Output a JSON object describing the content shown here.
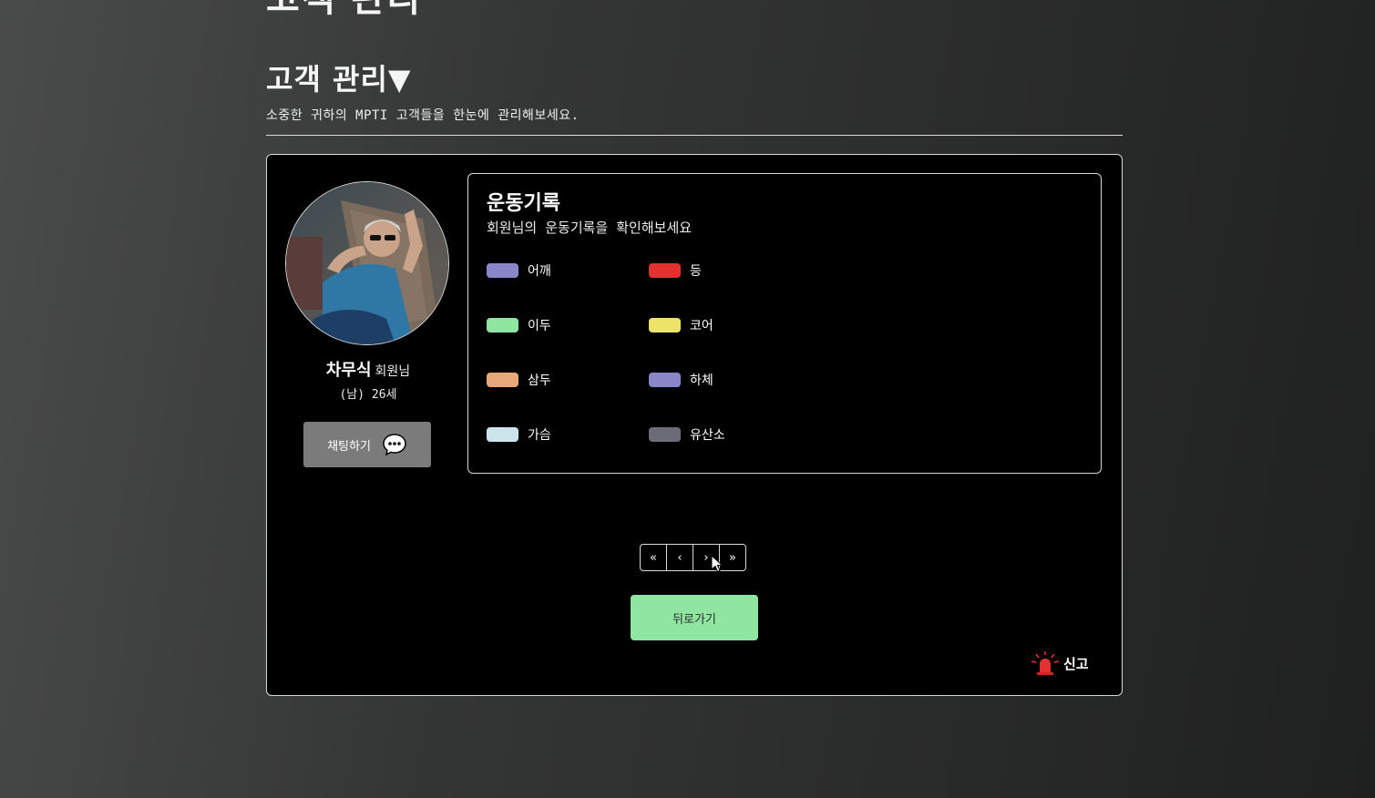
{
  "page": {
    "top_cut_title": "고객 관리",
    "section_title": "고객 관리▼",
    "section_desc": "소중한 귀하의 MPTI 고객들을 한눈에 관리해보세요."
  },
  "member": {
    "name": "차무식",
    "suffix": "회원님",
    "info": "(남) 26세",
    "chat_label": "채팅하기",
    "avatar_icon": "profile-photo"
  },
  "records": {
    "title": "운동기록",
    "subtitle": "회원님의 운동기록을 확인해보세요",
    "legend": [
      {
        "label": "어깨",
        "color": "#8b85c9"
      },
      {
        "label": "등",
        "color": "#e53030"
      },
      {
        "label": "이두",
        "color": "#8ee6a1"
      },
      {
        "label": "코어",
        "color": "#ede36a"
      },
      {
        "label": "삼두",
        "color": "#e9a878"
      },
      {
        "label": "하체",
        "color": "#8b85c9"
      },
      {
        "label": "가슴",
        "color": "#cce5ec"
      },
      {
        "label": "유산소",
        "color": "#6c6b78"
      }
    ]
  },
  "pager": {
    "first": "«",
    "prev": "‹",
    "next": "›",
    "last": "»"
  },
  "back_label": "뒤로가기",
  "report_label": "신고",
  "colors": {
    "card_bg": "#000000",
    "back_button": "#8ee6a1",
    "chat_button": "#7b7b7b",
    "siren": "#e53030"
  }
}
